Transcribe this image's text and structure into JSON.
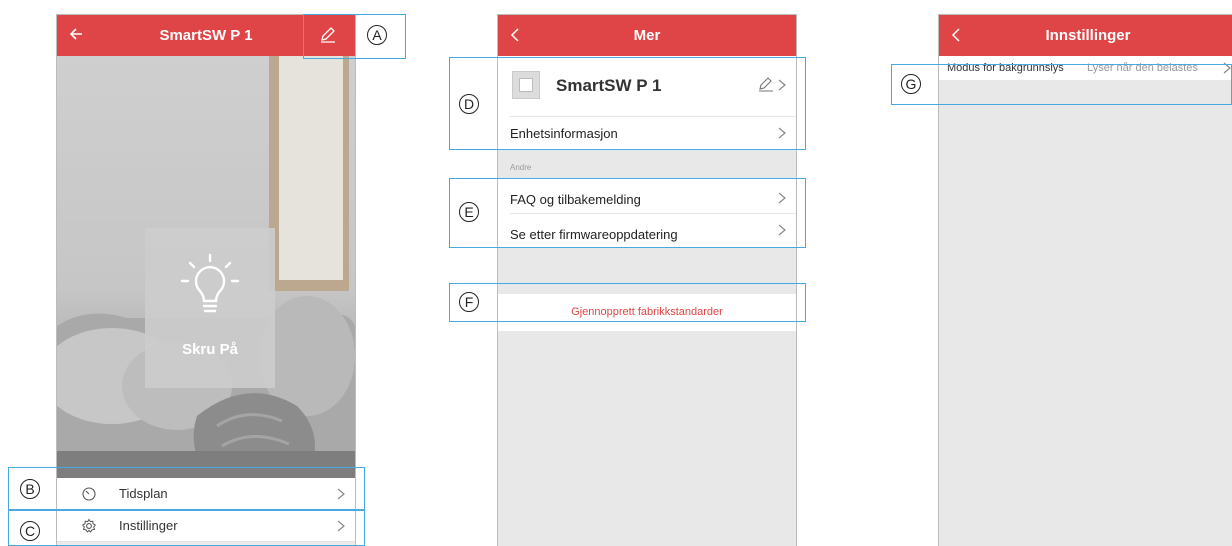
{
  "screen1": {
    "title": "SmartSW P 1",
    "tile_label": "Skru På",
    "menu": [
      {
        "label": "Tidsplan",
        "icon": "clock-icon"
      },
      {
        "label": "Instillinger",
        "icon": "gear-icon"
      }
    ]
  },
  "screen2": {
    "title": "Mer",
    "device_name": "SmartSW P 1",
    "device_info": "Enhetsinformasjon",
    "section": "Andre",
    "faq": "FAQ og tilbakemelding",
    "firmware": "Se etter firmwareoppdatering",
    "reset": "Gjennopprett fabrikkstandarder"
  },
  "screen3": {
    "title": "Innstillinger",
    "setting_label": "Modus for bakgrunnslys",
    "setting_value": "Lyser når den belastes"
  },
  "callouts": [
    "A",
    "B",
    "C",
    "D",
    "E",
    "F",
    "G"
  ],
  "colors": {
    "accent": "#df4446",
    "callout": "#4aa8e0"
  }
}
